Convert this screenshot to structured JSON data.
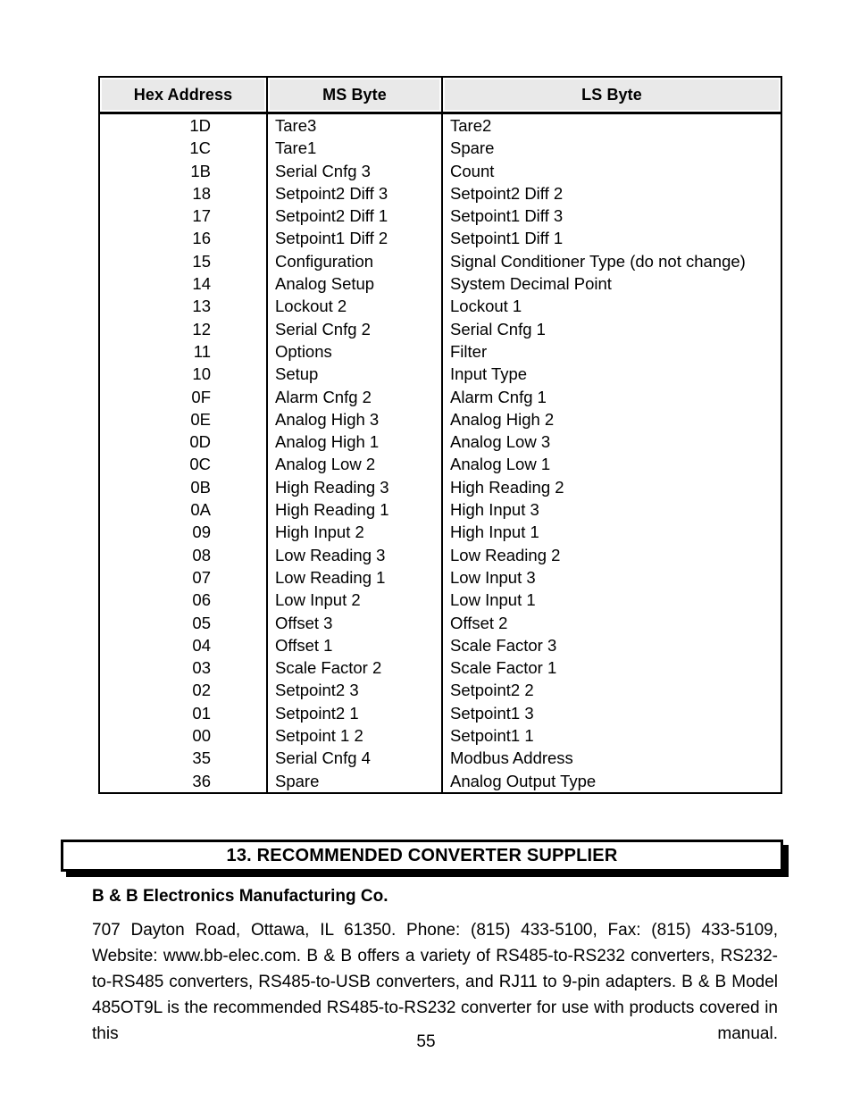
{
  "table": {
    "headers": [
      "Hex Address",
      "MS Byte",
      "LS Byte"
    ],
    "rows": [
      {
        "hex": "1D",
        "ms": "Tare3",
        "ls": "Tare2"
      },
      {
        "hex": "1C",
        "ms": "Tare1",
        "ls": "Spare"
      },
      {
        "hex": "1B",
        "ms": "Serial Cnfg 3",
        "ls": "Count"
      },
      {
        "hex": "18",
        "ms": "Setpoint2 Diff 3",
        "ls": "Setpoint2 Diff 2"
      },
      {
        "hex": "17",
        "ms": "Setpoint2 Diff 1",
        "ls": "Setpoint1 Diff 3"
      },
      {
        "hex": "16",
        "ms": "Setpoint1 Diff 2",
        "ls": "Setpoint1 Diff 1"
      },
      {
        "hex": "15",
        "ms": "Configuration",
        "ls": "Signal Conditioner Type (do not change)"
      },
      {
        "hex": "14",
        "ms": "Analog Setup",
        "ls": "System Decimal Point"
      },
      {
        "hex": "13",
        "ms": "Lockout 2",
        "ls": "Lockout 1"
      },
      {
        "hex": "12",
        "ms": "Serial Cnfg 2",
        "ls": "Serial Cnfg 1"
      },
      {
        "hex": "11",
        "ms": "Options",
        "ls": "Filter"
      },
      {
        "hex": "10",
        "ms": "Setup",
        "ls": "Input Type"
      },
      {
        "hex": "0F",
        "ms": "Alarm Cnfg 2",
        "ls": "Alarm Cnfg 1"
      },
      {
        "hex": "0E",
        "ms": "Analog High 3",
        "ls": "Analog High 2"
      },
      {
        "hex": "0D",
        "ms": "Analog High 1",
        "ls": "Analog Low 3"
      },
      {
        "hex": "0C",
        "ms": "Analog Low 2",
        "ls": "Analog Low 1"
      },
      {
        "hex": "0B",
        "ms": "High Reading 3",
        "ls": "High Reading 2"
      },
      {
        "hex": "0A",
        "ms": "High Reading 1",
        "ls": "High Input 3"
      },
      {
        "hex": "09",
        "ms": "High Input 2",
        "ls": "High Input 1"
      },
      {
        "hex": "08",
        "ms": "Low Reading 3",
        "ls": "Low Reading 2"
      },
      {
        "hex": "07",
        "ms": "Low Reading 1",
        "ls": "Low Input 3"
      },
      {
        "hex": "06",
        "ms": "Low Input 2",
        "ls": "Low Input 1"
      },
      {
        "hex": "05",
        "ms": "Offset 3",
        "ls": "Offset 2"
      },
      {
        "hex": "04",
        "ms": "Offset 1",
        "ls": "Scale Factor 3"
      },
      {
        "hex": "03",
        "ms": "Scale Factor 2",
        "ls": "Scale Factor 1"
      },
      {
        "hex": "02",
        "ms": "Setpoint2 3",
        "ls": "Setpoint2 2"
      },
      {
        "hex": "01",
        "ms": "Setpoint2 1",
        "ls": "Setpoint1 3"
      },
      {
        "hex": "00",
        "ms": "Setpoint 1 2",
        "ls": "Setpoint1 1"
      },
      {
        "hex": "35",
        "ms": "Serial Cnfg 4",
        "ls": "Modbus Address"
      },
      {
        "hex": "36",
        "ms": "Spare",
        "ls": "Analog Output Type"
      }
    ]
  },
  "section": {
    "heading": "13.  RECOMMENDED CONVERTER SUPPLIER"
  },
  "supplier": {
    "name": "B & B Electronics Manufacturing Co.",
    "paragraph": "707 Dayton Road, Ottawa, IL 61350. Phone: (815) 433-5100, Fax: (815) 433-5109, Website: www.bb-elec.com. B & B offers a variety of RS485-to-RS232 converters, RS232-to-RS485 converters, RS485-to-USB converters, and RJ11 to 9-pin adapters. B & B Model 485OT9L is the recommended RS485-to-RS232 converter for use with products covered in this manual."
  },
  "footer": {
    "page_number": "55"
  }
}
